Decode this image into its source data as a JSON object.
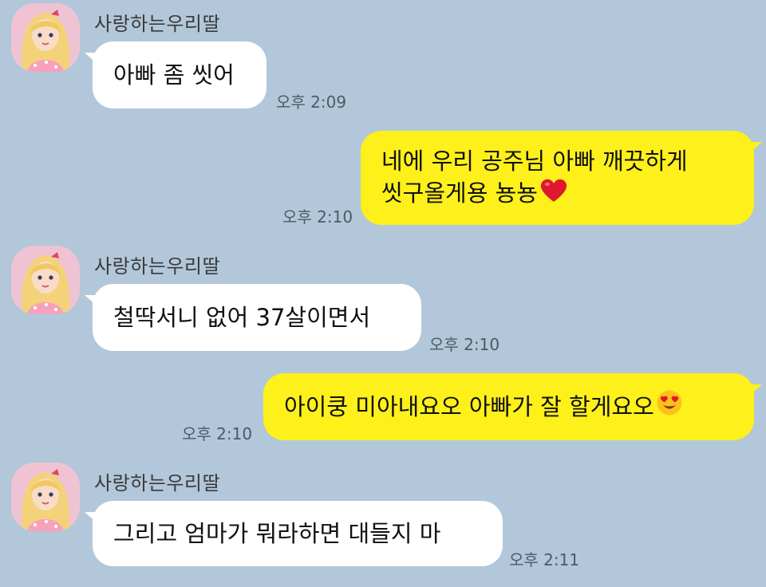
{
  "messages": [
    {
      "type": "incoming",
      "sender": "사랑하는우리딸",
      "text": "아빠 좀 씻어",
      "time": "오후 2:09"
    },
    {
      "type": "outgoing",
      "line1": "네에 우리 공주님 아빠 깨끗하게",
      "line2": "씻구올게용 뇽뇽",
      "emoji": "red-heart",
      "time": "오후 2:10"
    },
    {
      "type": "incoming",
      "sender": "사랑하는우리딸",
      "text": "철딱서니 없어 37살이면서",
      "time": "오후 2:10"
    },
    {
      "type": "outgoing",
      "text": "아이쿵 미아내요오 아빠가 잘 할게요오",
      "emoji": "heart-eyes-face",
      "time": "오후 2:10"
    },
    {
      "type": "incoming",
      "sender": "사랑하는우리딸",
      "text": "그리고 엄마가 뭐라하면 대들지 마",
      "time": "오후 2:11"
    }
  ],
  "colors": {
    "background": "#b2c7da",
    "incoming_bubble": "#ffffff",
    "outgoing_bubble": "#fef01b"
  }
}
